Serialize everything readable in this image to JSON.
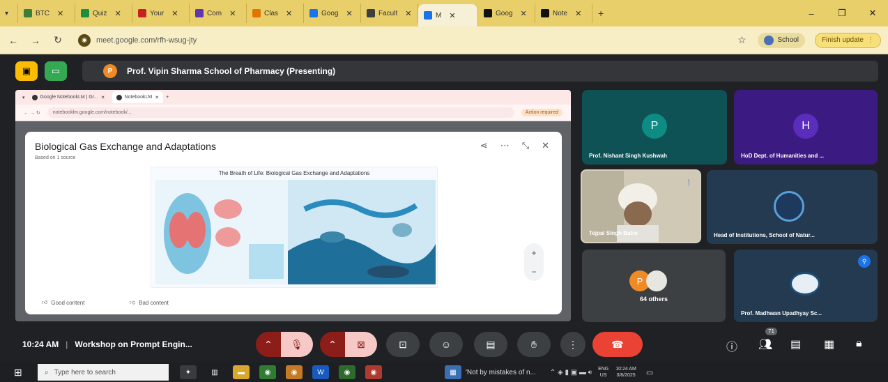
{
  "browser": {
    "tabs": [
      {
        "label": "BTC",
        "color": "#3b7d3b",
        "icon": "site-icon"
      },
      {
        "label": "Quiz",
        "color": "#1e8e3e",
        "icon": "forms-icon"
      },
      {
        "label": "Your",
        "color": "#c5221f",
        "icon": "gmail-icon"
      },
      {
        "label": "Com",
        "color": "#5f35b0",
        "icon": "classroom-icon"
      },
      {
        "label": "Clas",
        "color": "#e37400",
        "icon": "classroom-icon"
      },
      {
        "label": "Goog",
        "color": "#1a73e8",
        "icon": "google-icon"
      },
      {
        "label": "Facult",
        "color": "#3c4043",
        "icon": "site-icon"
      },
      {
        "label": "M",
        "color": "#1a73e8",
        "icon": "meet-icon",
        "active": true
      },
      {
        "label": "Goog",
        "color": "#111111",
        "icon": "notebook-icon"
      },
      {
        "label": "Note",
        "color": "#111111",
        "icon": "notebook-icon"
      }
    ],
    "new_tab": "+",
    "url": "meet.google.com/rfh-wsug-jty",
    "profile_label": "School",
    "update_label": "Finish update"
  },
  "meet": {
    "presenting_label": "Prof. Vipin Sharma School of Pharmacy (Presenting)",
    "presenter_initial": "P",
    "time": "10:24 AM",
    "separator": "|",
    "meeting_title": "Workshop on Prompt Engin...",
    "raise_count": "71"
  },
  "shared": {
    "inner_tabs": [
      "Google NotebookLM | Gr...",
      "NotebookLM"
    ],
    "inner_url": "notebooklm.google.com/notebook/...",
    "inner_action": "Action required",
    "nb_title": "Biological Gas Exchange and Adaptations",
    "nb_sub": "Based on 1 source",
    "info_title": "The Breath of Life: Biological Gas Exchange and Adaptations",
    "good_label": "Good content",
    "bad_label": "Bad content",
    "zoom_in": "+",
    "zoom_out": "−"
  },
  "participants": [
    {
      "name": "Prof. Nishant Singh Kushwah",
      "initial": "P",
      "bg": "#0f5256",
      "avatar": "#0e8c84"
    },
    {
      "name": "HoD Dept. of Humanities and ...",
      "initial": "H",
      "bg": "#3b1b82",
      "avatar": "#5b2dbd"
    },
    {
      "name": "Tejpal Singh Batra",
      "bg": "#c7c0ad"
    },
    {
      "name": "Head of Institutions, School of Natur...",
      "bg": "#233a50"
    },
    {
      "name": "64 others",
      "initial": "P",
      "bg": "#3c4043"
    },
    {
      "name": "Prof. Madhwan Upadhyay Sc...",
      "bg": "#233a50"
    }
  ],
  "taskbar": {
    "search_placeholder": "Type here to search",
    "notification": "'Not by mistakes of n...",
    "lang": "ENG",
    "region": "US",
    "time": "10:24 AM",
    "date": "3/8/2025"
  }
}
